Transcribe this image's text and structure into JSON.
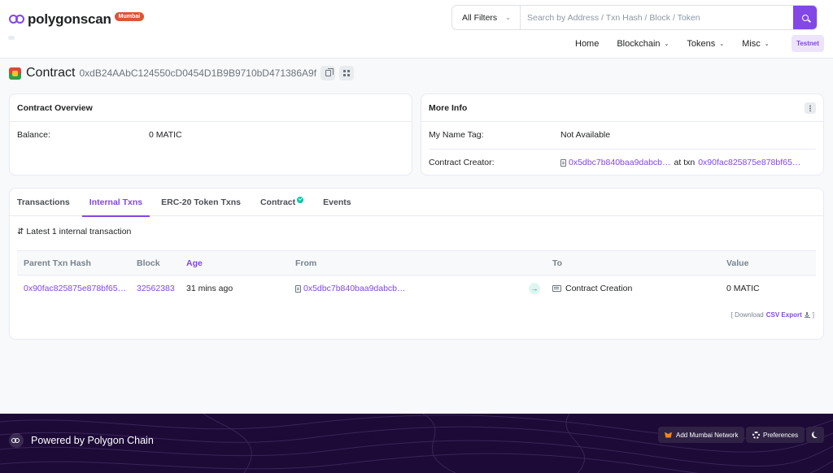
{
  "header": {
    "brand": "polygonscan",
    "network_badge": "Mumbai",
    "filter_label": "All Filters",
    "search_placeholder": "Search by Address / Txn Hash / Block / Token",
    "nav": [
      "Home",
      "Blockchain",
      "Tokens",
      "Misc"
    ],
    "testnet_label": "Testnet"
  },
  "contract": {
    "label": "Contract",
    "address": "0xdB24AAbC124550cD0454D1B9B9710bD471386A9f"
  },
  "overview": {
    "title": "Contract Overview",
    "balance_label": "Balance:",
    "balance_value": "0 MATIC"
  },
  "more_info": {
    "title": "More Info",
    "name_tag_label": "My Name Tag:",
    "name_tag_value": "Not Available",
    "creator_label": "Contract Creator:",
    "creator_address": "0x5dbc7b840baa9dabcb…",
    "at_txn_label": "at txn",
    "creator_txn": "0x90fac825875e878bf65…"
  },
  "tabs": [
    "Transactions",
    "Internal Txns",
    "ERC-20 Token Txns",
    "Contract",
    "Events"
  ],
  "active_tab": "Internal Txns",
  "internal_txns": {
    "summary": "Latest 1 internal transaction",
    "columns": [
      "Parent Txn Hash",
      "Block",
      "Age",
      "From",
      "To",
      "Value"
    ],
    "rows": [
      {
        "parent_txn_hash": "0x90fac825875e878bf65…",
        "block": "32562383",
        "age": "31 mins ago",
        "from": "0x5dbc7b840baa9dabcb…",
        "to": "Contract Creation",
        "value": "0 MATIC"
      }
    ],
    "export": {
      "prefix": "[ Download",
      "link": "CSV Export",
      "suffix": "]"
    }
  },
  "footer": {
    "powered_by": "Powered by Polygon Chain",
    "add_network": "Add Mumbai Network",
    "preferences": "Preferences"
  },
  "colors": {
    "accent": "#8247e5",
    "footer_bg": "#1d0a37",
    "badge_red": "#e0523a",
    "success": "#00c9a7"
  }
}
